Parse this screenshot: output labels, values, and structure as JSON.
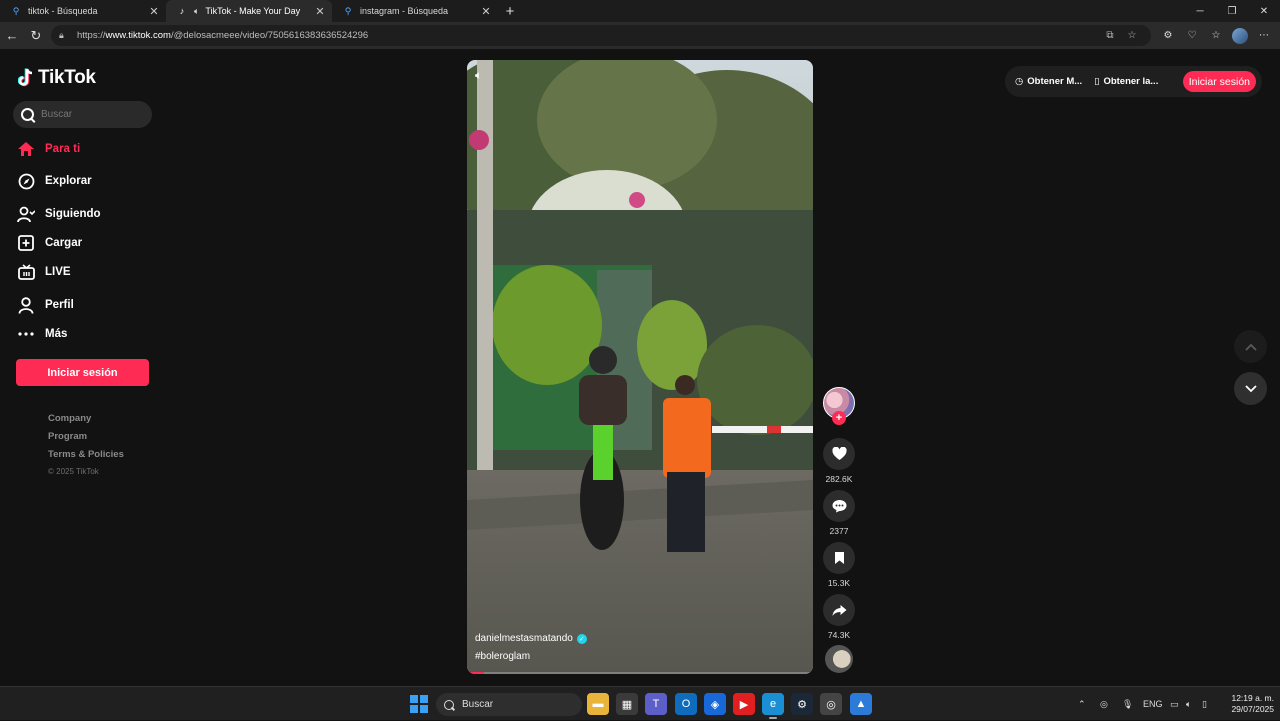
{
  "browser": {
    "tabs": [
      {
        "title": "tiktok - Búsqueda",
        "icon": "search-icon",
        "active": false
      },
      {
        "title": "TikTok - Make Your Day",
        "icon": "tiktok-icon",
        "active": true
      },
      {
        "title": "instagram - Búsqueda",
        "icon": "search-icon",
        "active": false
      }
    ],
    "new_tab": "+",
    "url_prefix": "https://",
    "url_host": "www.tiktok.com",
    "url_path": "/@delosacmeee/video/7505616383636524296"
  },
  "sidebar": {
    "logo_text": "TikTok",
    "search_placeholder": "Buscar",
    "nav": [
      {
        "label": "Para ti",
        "icon": "home-icon"
      },
      {
        "label": "Explorar",
        "icon": "compass-icon"
      },
      {
        "label": "Siguiendo",
        "icon": "following-icon"
      },
      {
        "label": "Cargar",
        "icon": "upload-icon"
      },
      {
        "label": "LIVE",
        "icon": "live-icon"
      },
      {
        "label": "Perfil",
        "icon": "profile-icon"
      },
      {
        "label": "Más",
        "icon": "more-icon"
      }
    ],
    "login_label": "Iniciar sesión",
    "footer": {
      "company": "Company",
      "program": "Program",
      "terms": "Terms & Policies",
      "copyright": "© 2025 TikTok"
    }
  },
  "video": {
    "username": "danielmestasmatando",
    "hashtag": "#boleroglam",
    "progress": 0.05
  },
  "actions": {
    "likes": "282.6K",
    "comments": "2377",
    "saves": "15.3K",
    "shares": "74.3K"
  },
  "header": {
    "get_app_1": "Obtener M...",
    "get_app_2": "Obtener la...",
    "login_label": "Iniciar sesión"
  },
  "taskbar": {
    "search_label": "Buscar",
    "language": "ENG",
    "time": "12:19 a. m.",
    "date": "29/07/2025"
  },
  "colors": {
    "accent": "#fe2c55",
    "background": "#121212"
  }
}
